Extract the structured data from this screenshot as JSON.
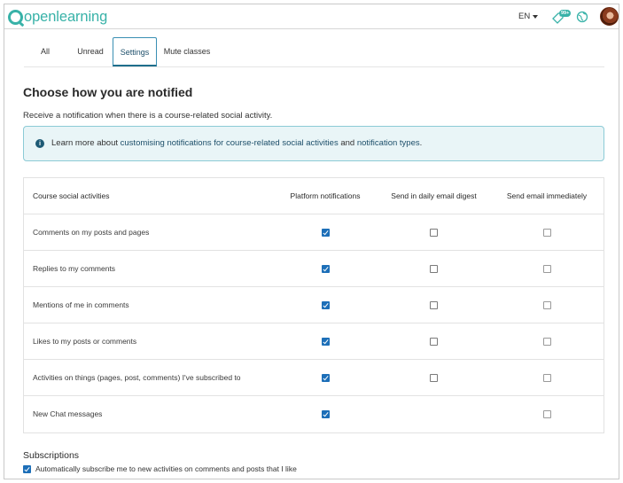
{
  "header": {
    "logo_text": "openlearning",
    "language": "EN",
    "notification_badge": "99+",
    "brand_color": "#38b2a8"
  },
  "tabs": [
    {
      "label": "All"
    },
    {
      "label": "Unread"
    },
    {
      "label": "Settings",
      "active": true
    },
    {
      "label": "Mute classes"
    }
  ],
  "settings": {
    "title": "Choose how you are notified",
    "intro": "Receive a notification when there is a course-related social activity.",
    "info": {
      "prefix": "Learn more about ",
      "link1": "customising notifications for course-related social activities",
      "middle": " and ",
      "link2": "notification types",
      "suffix": "."
    }
  },
  "table": {
    "headers": [
      "Course social activities",
      "Platform notifications",
      "Send in daily email digest",
      "Send email immediately"
    ],
    "rows": [
      {
        "label": "Comments on my posts and pages",
        "platform": true,
        "digest": false,
        "immediate": false
      },
      {
        "label": "Replies to my comments",
        "platform": true,
        "digest": false,
        "immediate": false
      },
      {
        "label": "Mentions of me in comments",
        "platform": true,
        "digest": false,
        "immediate": false
      },
      {
        "label": "Likes to my posts or comments",
        "platform": true,
        "digest": false,
        "immediate": false
      },
      {
        "label": "Activities on things (pages, post, comments) I've subscribed to",
        "platform": true,
        "digest": false,
        "immediate": false
      },
      {
        "label": "New Chat messages",
        "platform": true,
        "digest": null,
        "immediate": false
      }
    ]
  },
  "subscriptions": {
    "title": "Subscriptions",
    "option_label": "Automatically subscribe me to new activities on comments and posts that I like",
    "checked": true
  }
}
